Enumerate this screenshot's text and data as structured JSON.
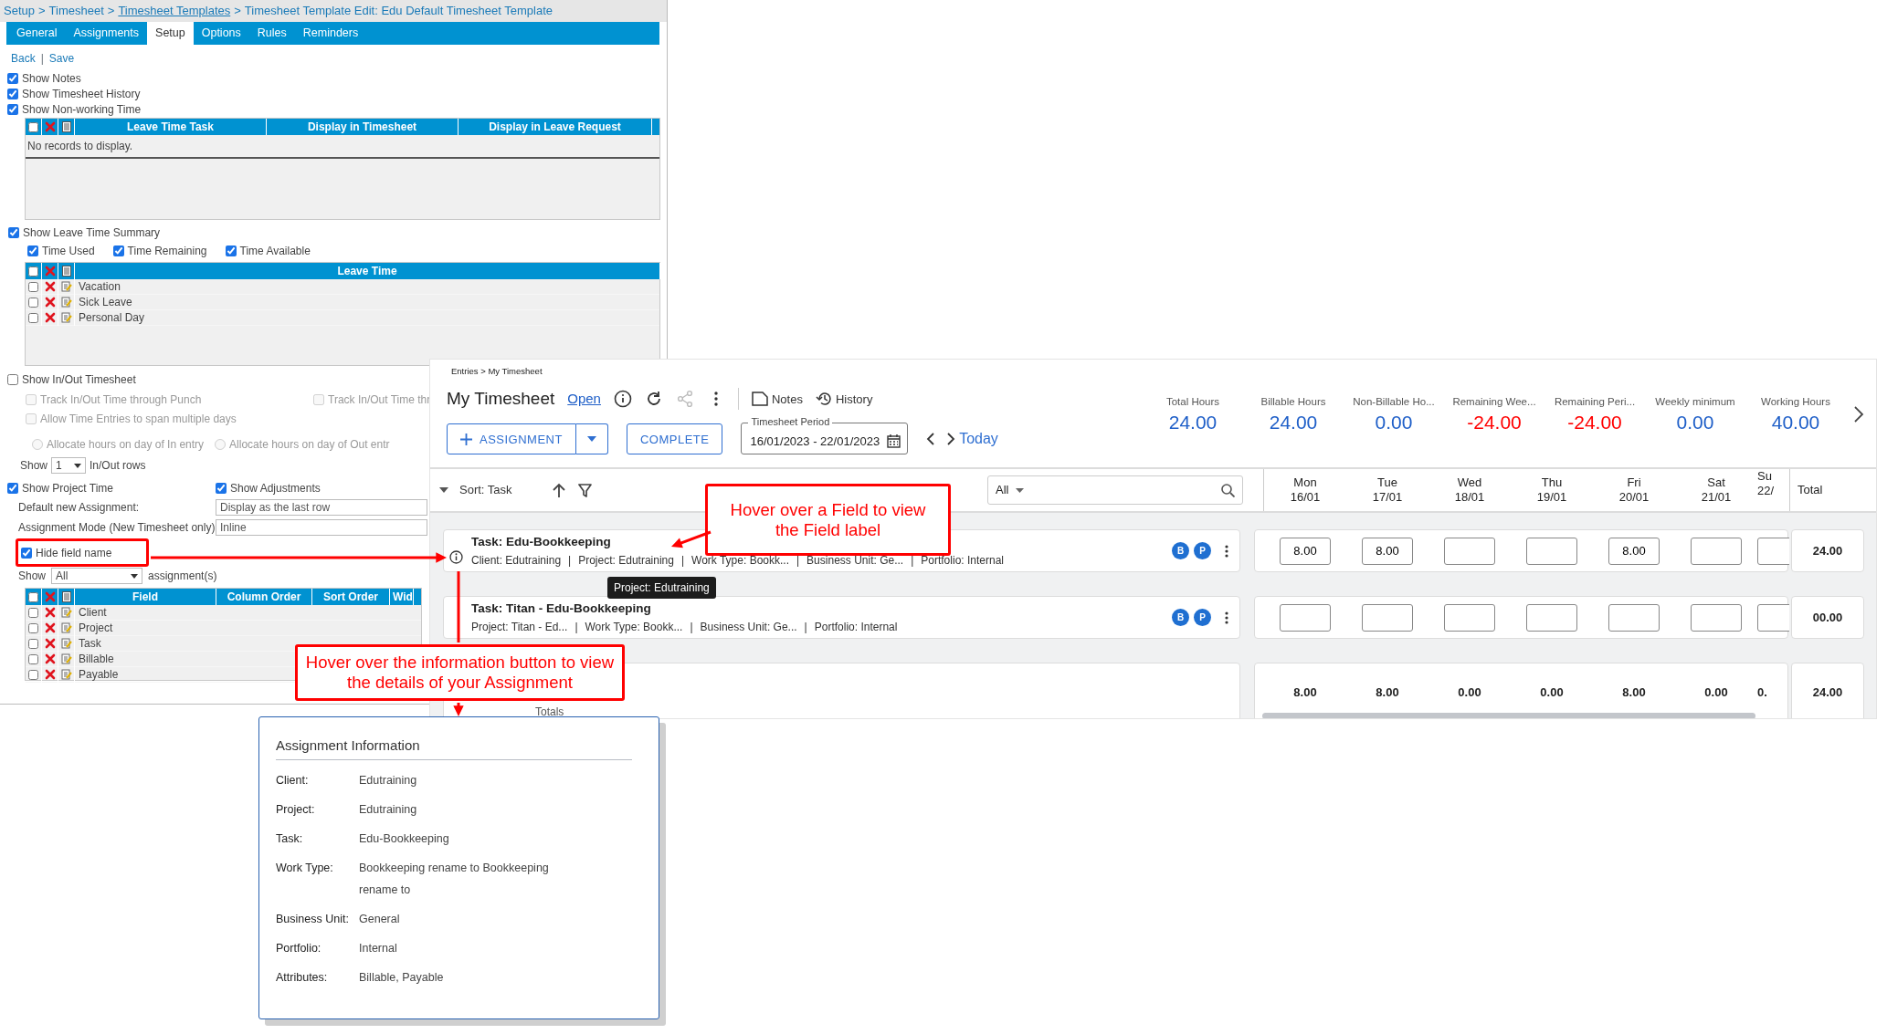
{
  "template_editor": {
    "breadcrumb": {
      "separator": ">",
      "items": [
        {
          "text": "Setup",
          "link": false
        },
        {
          "text": "Timesheet",
          "link": false
        },
        {
          "text": "Timesheet Templates",
          "link": true
        },
        {
          "text": "Timesheet Template Edit: Edu Default Timesheet Template",
          "link": false
        }
      ]
    },
    "tabs": [
      {
        "label": "General",
        "selected": false
      },
      {
        "label": "Assignments",
        "selected": false
      },
      {
        "label": "Setup",
        "selected": true
      },
      {
        "label": "Options",
        "selected": false
      },
      {
        "label": "Rules",
        "selected": false
      },
      {
        "label": "Reminders",
        "selected": false
      }
    ],
    "actions": {
      "separator": "|",
      "links": [
        "Back",
        "Save"
      ]
    },
    "options": [
      {
        "label": "Show Notes",
        "checked": true
      },
      {
        "label": "Show Timesheet History",
        "checked": true
      },
      {
        "label": "Show Non-working Time",
        "checked": true
      }
    ],
    "leave_task_grid": {
      "columns": [
        "Leave Time Task",
        "Display in Timesheet",
        "Display in Leave Request"
      ],
      "all_checked": false,
      "empty_message": "No records to display."
    },
    "leave_summary": {
      "label": "Show Leave Time Summary",
      "checked": true
    },
    "leave_summary_options": [
      {
        "label": "Time Used",
        "checked": true
      },
      {
        "label": "Time Remaining",
        "checked": true
      },
      {
        "label": "Time Available",
        "checked": true
      }
    ],
    "leave_time_grid": {
      "columns": [
        "Leave Time"
      ],
      "all_checked": false,
      "rows": [
        {
          "label": "Vacation",
          "checked": false
        },
        {
          "label": "Sick Leave",
          "checked": false
        },
        {
          "label": "Personal Day",
          "checked": false
        }
      ]
    },
    "in_out": {
      "label": "Show In/Out Timesheet",
      "checked": false
    },
    "in_out_options": [
      {
        "label": "Track In/Out Time through Punch",
        "checked": false,
        "disabled": true
      },
      {
        "label": "Track In/Out Time thr",
        "checked": false,
        "disabled": true
      },
      {
        "label": "Allow Time Entries to span multiple days",
        "checked": false,
        "disabled": true
      }
    ],
    "allocate_options": [
      {
        "label": "Allocate hours on day of In entry",
        "selected": false
      },
      {
        "label": "Allocate hours on day of Out entr",
        "selected": false
      }
    ],
    "rows_select": {
      "prefix": "Show",
      "value": "1",
      "suffix": "In/Out rows"
    },
    "project_time": {
      "label": "Show Project Time",
      "checked": true
    },
    "adjustments": {
      "label": "Show Adjustments",
      "checked": true
    },
    "default_assignment": {
      "label": "Default new Assignment:",
      "value": "Display as the last row"
    },
    "assignment_mode": {
      "label": "Assignment Mode (New Timesheet only)",
      "value": "Inline"
    },
    "hide_field_name": {
      "label": "Hide field name",
      "checked": true
    },
    "show_select": {
      "prefix": "Show",
      "value": "All",
      "suffix": "assignment(s)"
    },
    "field_grid": {
      "columns": [
        "Field",
        "Column Order",
        "Sort Order",
        "Wid"
      ],
      "all_checked": false,
      "rows": [
        {
          "label": "Client",
          "checked": false
        },
        {
          "label": "Project",
          "checked": false
        },
        {
          "label": "Task",
          "checked": false
        },
        {
          "label": "Billable",
          "checked": false
        },
        {
          "label": "Payable",
          "checked": false
        }
      ]
    }
  },
  "timesheet": {
    "breadcrumb": "Entries > My Timesheet",
    "title": "My Timesheet",
    "status": "Open",
    "toolbar": [
      {
        "kind": "info",
        "disabled": false
      },
      {
        "kind": "refresh",
        "disabled": false
      },
      {
        "kind": "share",
        "disabled": true
      },
      {
        "kind": "more",
        "disabled": false
      }
    ],
    "links": [
      {
        "kind": "notes",
        "label": "Notes"
      },
      {
        "kind": "history",
        "label": "History"
      }
    ],
    "stats": [
      {
        "label": "Total Hours",
        "value": "24.00",
        "color": "#1f5fc8"
      },
      {
        "label": "Billable Hours",
        "value": "24.00",
        "color": "#1f5fc8"
      },
      {
        "label": "Non-Billable Ho...",
        "value": "0.00",
        "color": "#1f5fc8"
      },
      {
        "label": "Remaining Wee...",
        "value": "-24.00",
        "color": "#ff0000"
      },
      {
        "label": "Remaining Peri...",
        "value": "-24.00",
        "color": "#ff0000"
      },
      {
        "label": "Weekly minimum",
        "value": "0.00",
        "color": "#1f5fc8"
      },
      {
        "label": "Working Hours",
        "value": "40.00",
        "color": "#1f5fc8"
      }
    ],
    "assignment_button": "ASSIGNMENT",
    "complete_button": "COMPLETE",
    "period": {
      "label": "Timesheet Period",
      "value": "16/01/2023 - 22/01/2023"
    },
    "today": "Today",
    "sort": "Sort: Task",
    "filter": "All",
    "days": [
      {
        "day": "Mon",
        "date": "16/01"
      },
      {
        "day": "Tue",
        "date": "17/01"
      },
      {
        "day": "Wed",
        "date": "18/01"
      },
      {
        "day": "Thu",
        "date": "19/01"
      },
      {
        "day": "Fri",
        "date": "20/01"
      },
      {
        "day": "Sat",
        "date": "21/01"
      },
      {
        "day": "Su",
        "date": "22/"
      }
    ],
    "total_label": "Total",
    "field_separator": "|",
    "rows": [
      {
        "task": "Task: Edu-Bookkeeping",
        "info_button": true,
        "fields": [
          "Client: Edutraining",
          "Project: Edutraining",
          "Work Type: Bookk...",
          "Business Unit: Ge...",
          "Portfolio: Internal"
        ],
        "badges": [
          "B",
          "P"
        ],
        "hours": {
          "day_1": "8.00",
          "day_2": "8.00",
          "day_5": "8.00"
        },
        "total": "24.00"
      },
      {
        "task": "Task: Titan - Edu-Bookkeeping",
        "fields": [
          "Project: Titan - Ed...",
          "Work Type: Bookk...",
          "Business Unit: Ge...",
          "Portfolio: Internal"
        ],
        "badges": [
          "B",
          "P"
        ],
        "total": "00.00"
      }
    ],
    "totals": {
      "label": "Totals",
      "values": [
        "8.00",
        "8.00",
        "0.00",
        "0.00",
        "8.00",
        "0.00",
        "0."
      ],
      "total": "24.00"
    },
    "tooltip": "Project: Edutraining"
  },
  "assignment_info": {
    "title": "Assignment Information",
    "rows": [
      {
        "label": "Client:",
        "value": "Edutraining"
      },
      {
        "label": "Project:",
        "value": "Edutraining"
      },
      {
        "label": "Task:",
        "value": "Edu-Bookkeeping"
      },
      {
        "label": "Work Type:",
        "value": "Bookkeeping rename to Bookkeeping rename to"
      },
      {
        "label": "Business Unit:",
        "value": "General"
      },
      {
        "label": "Portfolio:",
        "value": "Internal"
      },
      {
        "label": "Attributes:",
        "value": "Billable, Payable"
      }
    ]
  },
  "callouts": [
    "Hover over a Field to view the Field label",
    "Hover over the information button to view the details of your Assignment"
  ]
}
